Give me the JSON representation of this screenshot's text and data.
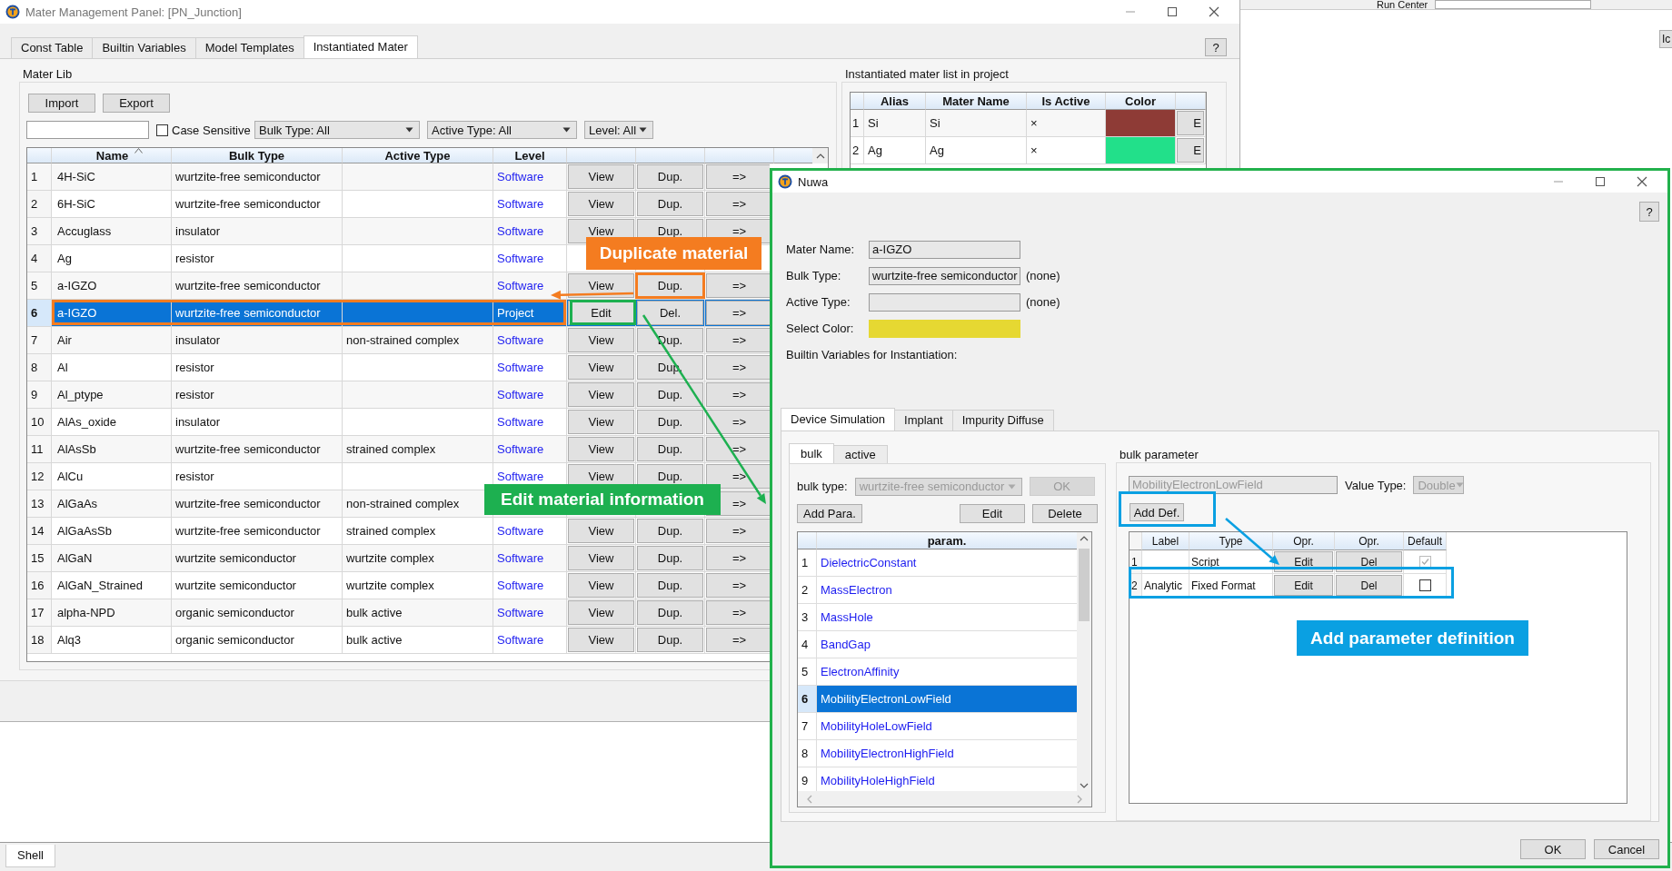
{
  "main_window": {
    "title": "Mater Management Panel: [PN_Junction]",
    "tabs": [
      {
        "label": "Const Table",
        "selected": false
      },
      {
        "label": "Builtin Variables",
        "selected": false
      },
      {
        "label": "Model Templates",
        "selected": false
      },
      {
        "label": "Instantiated Mater",
        "selected": true
      }
    ],
    "help_button": "?",
    "mater_lib": {
      "title": "Mater Lib",
      "buttons": [
        "Import",
        "Export"
      ],
      "case_sensitive": {
        "label": "Case Sensitive",
        "checked": false
      },
      "filters": [
        "Bulk Type: All",
        "Active Type: All",
        "Level: All"
      ],
      "table": {
        "columns": [
          "Name",
          "Bulk Type",
          "Active Type",
          "Level"
        ],
        "rows": [
          {
            "num": "1",
            "name": "4H-SiC",
            "bulk_type": "wurtzite-free semiconductor",
            "level": "Software",
            "button_1": "View",
            "button_2": "Dup.",
            "button_3": "=>",
            "selected": false
          },
          {
            "num": "2",
            "name": "6H-SiC",
            "bulk_type": "wurtzite-free semiconductor",
            "level": "Software",
            "button_1": "View",
            "button_2": "Dup.",
            "button_3": "=>",
            "selected": false
          },
          {
            "num": "3",
            "name": "Accuglass",
            "bulk_type": "insulator",
            "level": "Software",
            "button_1": "View",
            "button_2": "Dup.",
            "button_3": "=>",
            "selected": false
          },
          {
            "num": "4",
            "name": "Ag",
            "bulk_type": "resistor",
            "level": "Software",
            "selected": false
          },
          {
            "num": "5",
            "name": "a-IGZO",
            "bulk_type": "wurtzite-free semiconductor",
            "level": "Software",
            "button_1": "View",
            "button_2": "Dup.",
            "button_3": "=>",
            "selected": false
          },
          {
            "num": "6",
            "name": "a-IGZO",
            "bulk_type": "wurtzite-free semiconductor",
            "level": "Project",
            "button_1": "Edit",
            "button_2": "Del.",
            "button_3": "=>",
            "selected": true
          },
          {
            "num": "7",
            "name": "Air",
            "bulk_type": "insulator",
            "active_type": "non-strained complex",
            "level": "Software",
            "button_1": "View",
            "button_2": "Dup.",
            "button_3": "=>",
            "selected": false
          },
          {
            "num": "8",
            "name": "Al",
            "bulk_type": "resistor",
            "level": "Software",
            "button_1": "View",
            "button_2": "Dup.",
            "button_3": "=>",
            "selected": false
          },
          {
            "num": "9",
            "name": "Al_ptype",
            "bulk_type": "resistor",
            "level": "Software",
            "button_1": "View",
            "button_2": "Dup.",
            "button_3": "=>",
            "selected": false
          },
          {
            "num": "10",
            "name": "AlAs_oxide",
            "bulk_type": "insulator",
            "level": "Software",
            "button_1": "View",
            "button_2": "Dup.",
            "button_3": "=>",
            "selected": false
          },
          {
            "num": "11",
            "name": "AlAsSb",
            "bulk_type": "wurtzite-free semiconductor",
            "active_type": "strained complex",
            "level": "Software",
            "button_1": "View",
            "button_2": "Dup.",
            "button_3": "=>",
            "selected": false
          },
          {
            "num": "12",
            "name": "AlCu",
            "bulk_type": "resistor",
            "level": "Software",
            "button_1": "View",
            "button_2": "Dup.",
            "button_3": "=>",
            "selected": false
          },
          {
            "num": "13",
            "name": "AlGaAs",
            "bulk_type": "wurtzite-free semiconductor",
            "active_type": "non-strained complex",
            "button_3": "=>",
            "selected": false
          },
          {
            "num": "14",
            "name": "AlGaAsSb",
            "bulk_type": "wurtzite-free semiconductor",
            "active_type": "strained complex",
            "level": "Software",
            "button_1": "View",
            "button_2": "Dup.",
            "button_3": "=>",
            "selected": false
          },
          {
            "num": "15",
            "name": "AlGaN",
            "bulk_type": "wurtzite semiconductor",
            "active_type": "wurtzite complex",
            "level": "Software",
            "button_1": "View",
            "button_2": "Dup.",
            "button_3": "=>",
            "selected": false
          },
          {
            "num": "16",
            "name": "AlGaN_Strained",
            "bulk_type": "wurtzite semiconductor",
            "active_type": "wurtzite complex",
            "level": "Software",
            "button_1": "View",
            "button_2": "Dup.",
            "button_3": "=>",
            "selected": false
          },
          {
            "num": "17",
            "name": "alpha-NPD",
            "bulk_type": "organic semiconductor",
            "active_type": "bulk active",
            "level": "Software",
            "button_1": "View",
            "button_2": "Dup.",
            "button_3": "=>",
            "selected": false
          },
          {
            "num": "18",
            "name": "Alq3",
            "bulk_type": "organic semiconductor",
            "active_type": "bulk active",
            "level": "Software",
            "button_1": "View",
            "button_2": "Dup.",
            "button_3": "=>",
            "selected": false
          }
        ]
      }
    },
    "instantiated_list": {
      "title": "Instantiated mater list in project",
      "columns": [
        "Alias",
        "Mater Name",
        "Is Active",
        "Color"
      ],
      "rows": [
        {
          "num": "1",
          "alias": "Si",
          "mater_name": "Si",
          "is_active": "×",
          "color": "#8e3b36",
          "button": "E"
        },
        {
          "num": "2",
          "alias": "Ag",
          "mater_name": "Ag",
          "is_active": "×",
          "color": "#22e08a",
          "button": "E"
        }
      ]
    }
  },
  "background_window": {
    "label": "Run Center",
    "button": "Ic"
  },
  "bottom_tab": "Shell",
  "dialog": {
    "title": "Nuwa",
    "help_button": "?",
    "fields": [
      {
        "label": "Mater Name:",
        "value": "a-IGZO"
      },
      {
        "label": "Bulk Type:",
        "value": "wurtzite-free semiconductor",
        "note": "(none)"
      },
      {
        "label": "Active Type:",
        "note": "(none)"
      }
    ],
    "select_color": {
      "label": "Select Color:",
      "color": "#e6d832"
    },
    "builtin_label": "Builtin Variables for Instantiation:",
    "tabs": [
      {
        "label": "Device Simulation",
        "selected": true
      },
      {
        "label": "Implant",
        "selected": false
      },
      {
        "label": "Impurity Diffuse",
        "selected": false
      }
    ],
    "subtabs": [
      {
        "label": "bulk",
        "selected": true
      },
      {
        "label": "active",
        "selected": false
      }
    ],
    "bulk_type": {
      "label": "bulk type:",
      "value": "wurtzite-free semiconductor",
      "disabled": true
    },
    "ok_button": {
      "label": "OK",
      "disabled": true
    },
    "buttons": [
      "Add Para.",
      "Edit",
      "Delete"
    ],
    "params": {
      "column": "param.",
      "rows": [
        {
          "num": "1",
          "name": "DielectricConstant",
          "selected": false
        },
        {
          "num": "2",
          "name": "MassElectron",
          "selected": false
        },
        {
          "num": "3",
          "name": "MassHole",
          "selected": false
        },
        {
          "num": "4",
          "name": "BandGap",
          "selected": false
        },
        {
          "num": "5",
          "name": "ElectronAffinity",
          "selected": false
        },
        {
          "num": "6",
          "name": "MobilityElectronLowField",
          "selected": true
        },
        {
          "num": "7",
          "name": "MobilityHoleLowField",
          "selected": false
        },
        {
          "num": "8",
          "name": "MobilityElectronHighField",
          "selected": false
        },
        {
          "num": "9",
          "name": "MobilityHoleHighField",
          "selected": false
        }
      ]
    },
    "bulk_parameter": {
      "title": "bulk parameter",
      "name_value": "MobilityElectronLowField",
      "value_type": {
        "label": "Value Type:",
        "value": "Double"
      },
      "add_button": "Add Def.",
      "columns": [
        "Label",
        "Type",
        "Opr.",
        "Opr.",
        "Default"
      ],
      "rows": [
        {
          "num": "1",
          "type": "Script",
          "edit": "Edit",
          "del": "Del",
          "default_checked": true,
          "default_disabled": true
        },
        {
          "num": "2",
          "label": "Analytic",
          "type": "Fixed Format",
          "edit": "Edit",
          "del": "Del",
          "default_checked": false,
          "default_disabled": false
        }
      ]
    },
    "footer_buttons": [
      "OK",
      "Cancel"
    ]
  },
  "callouts": [
    {
      "text": "Duplicate material",
      "color": "#f47c20"
    },
    {
      "text": "Edit material information",
      "color": "#1db050"
    },
    {
      "text": "Add parameter definition",
      "color": "#0aa0e2"
    }
  ]
}
